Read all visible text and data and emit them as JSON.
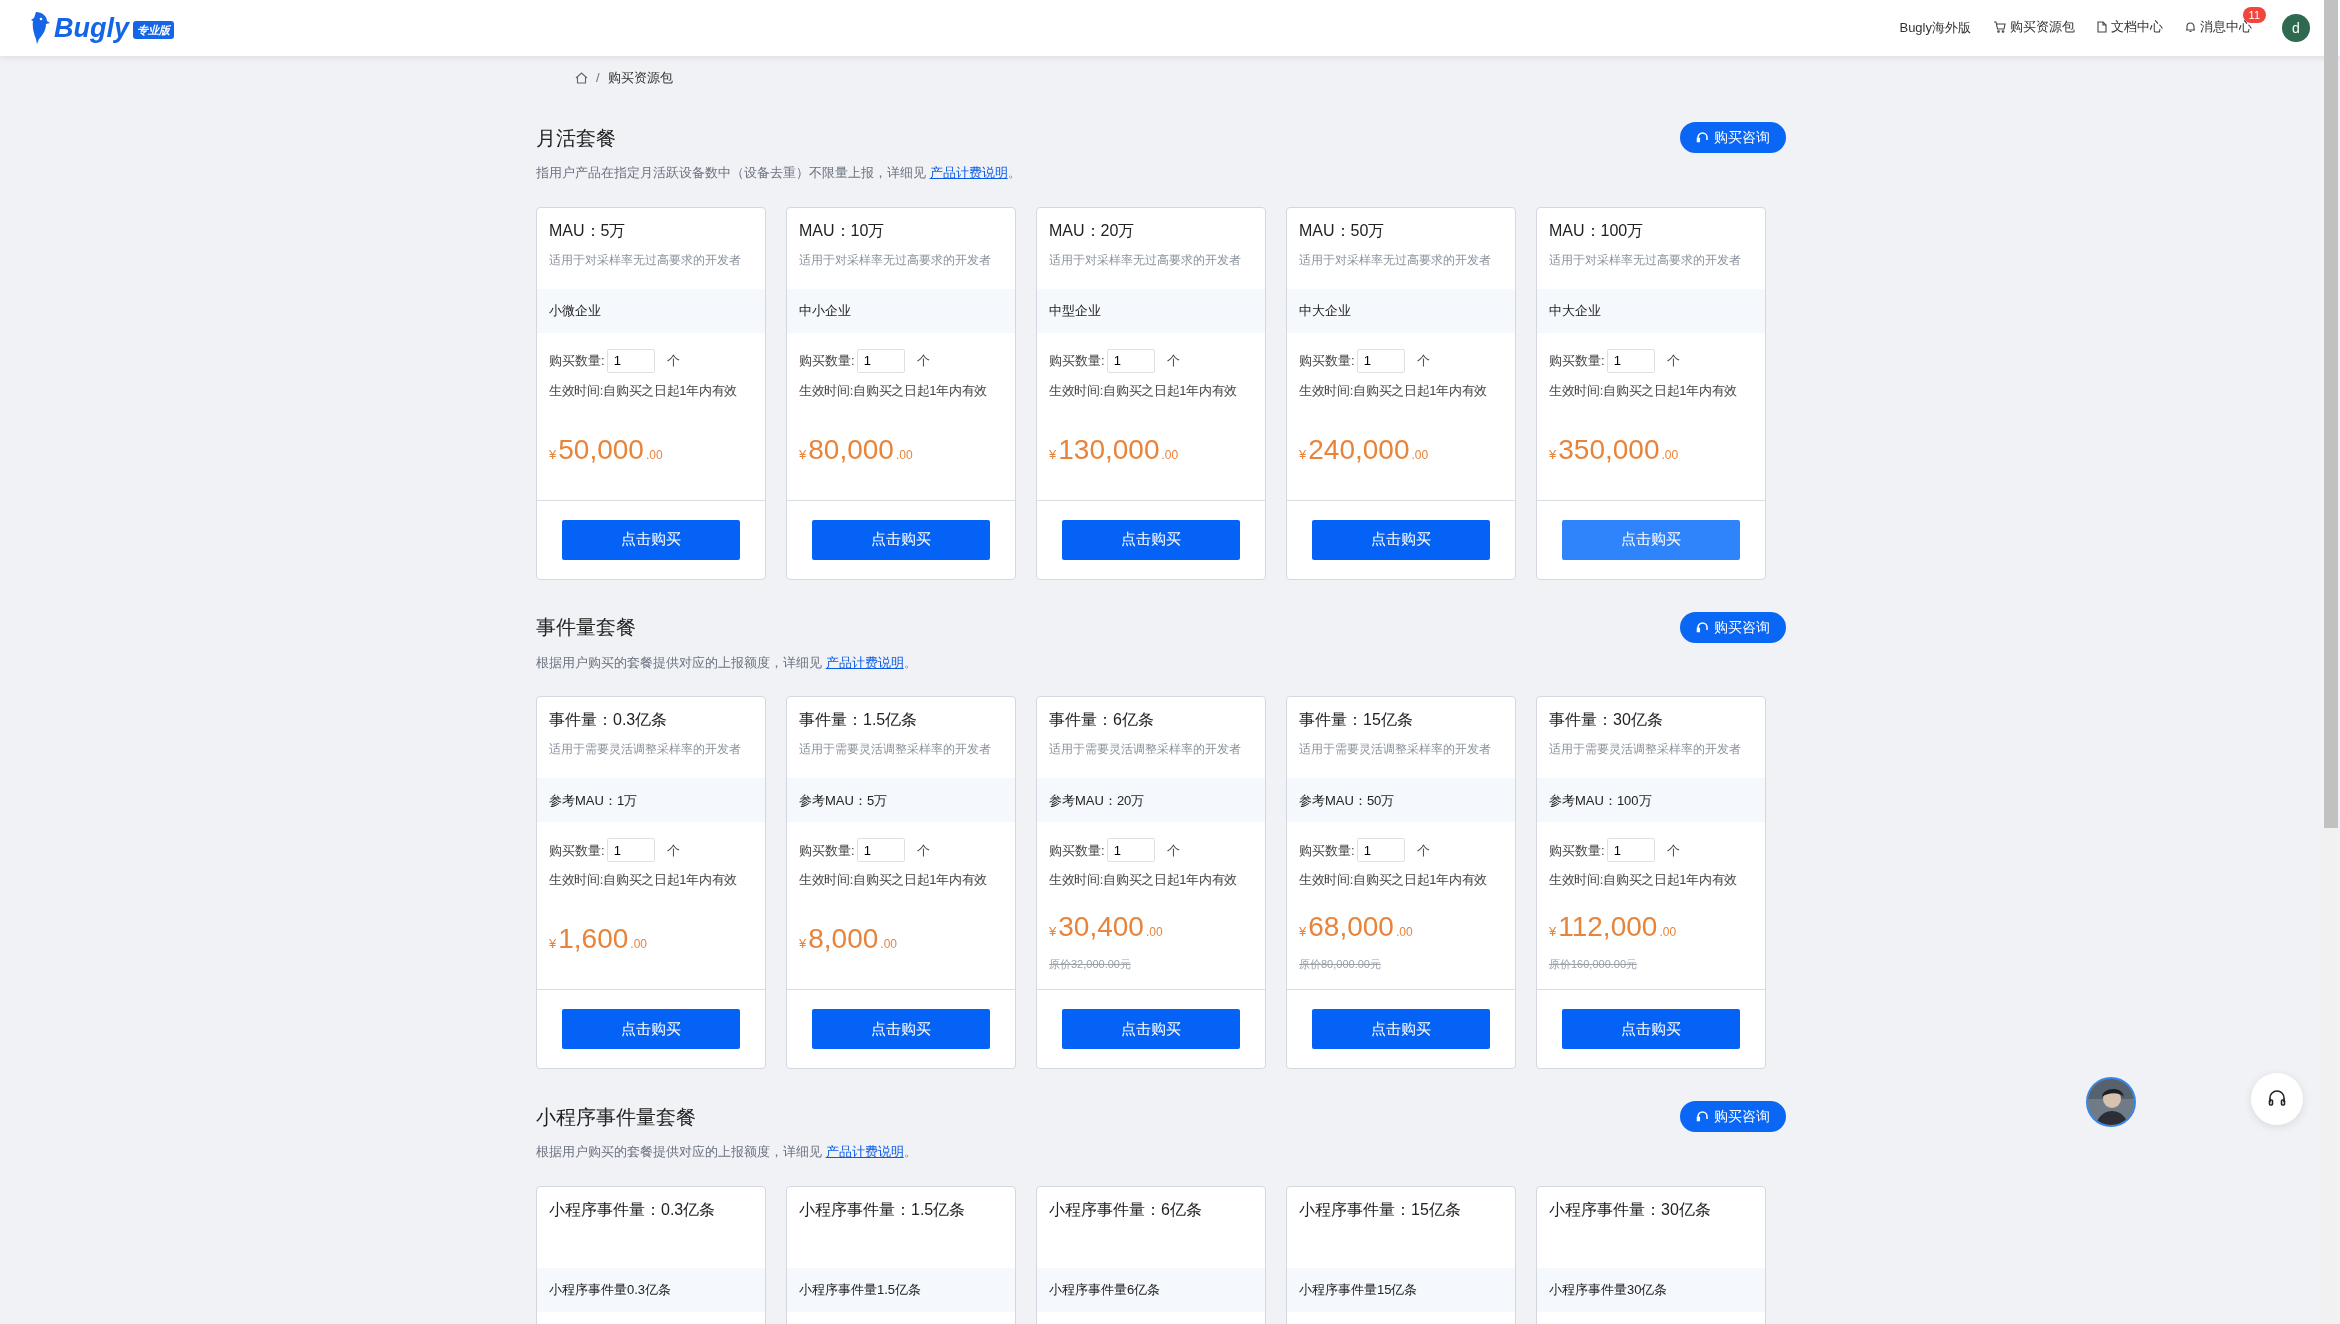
{
  "header": {
    "logo": "Bugly",
    "edition": "专业版",
    "nav": [
      {
        "label": "Bugly海外版",
        "kind": "plain"
      },
      {
        "label": "购买资源包",
        "kind": "cart"
      },
      {
        "label": "文档中心",
        "kind": "document"
      },
      {
        "label": "消息中心",
        "kind": "bell",
        "badge": "11"
      }
    ],
    "user_initial": "d"
  },
  "breadcrumb": {
    "separator": "/",
    "items": [
      "购买资源包"
    ]
  },
  "sections": [
    {
      "title": "月活套餐",
      "description": "指用户产品在指定月活跃设备数中（设备去重）不限量上报，详细见 ",
      "link": "产品计费说明",
      "suffix": "。",
      "consult_button": "购买咨询",
      "plans": [
        {
          "title": "MAU：5万",
          "subtitle": "适用于对采样率无过高要求的开发者",
          "tier": "小微企业",
          "quantity_label": "购买数量:",
          "quantity": "1",
          "unit": "个",
          "validity": "生效时间:自购买之日起1年内有效",
          "currency": "¥",
          "price": "50,000",
          "cents": ".00",
          "button": "点击购买",
          "highlighted": false
        },
        {
          "title": "MAU：10万",
          "subtitle": "适用于对采样率无过高要求的开发者",
          "tier": "中小企业",
          "quantity_label": "购买数量:",
          "quantity": "1",
          "unit": "个",
          "validity": "生效时间:自购买之日起1年内有效",
          "currency": "¥",
          "price": "80,000",
          "cents": ".00",
          "button": "点击购买",
          "highlighted": false
        },
        {
          "title": "MAU：20万",
          "subtitle": "适用于对采样率无过高要求的开发者",
          "tier": "中型企业",
          "quantity_label": "购买数量:",
          "quantity": "1",
          "unit": "个",
          "validity": "生效时间:自购买之日起1年内有效",
          "currency": "¥",
          "price": "130,000",
          "cents": ".00",
          "button": "点击购买",
          "highlighted": false
        },
        {
          "title": "MAU：50万",
          "subtitle": "适用于对采样率无过高要求的开发者",
          "tier": "中大企业",
          "quantity_label": "购买数量:",
          "quantity": "1",
          "unit": "个",
          "validity": "生效时间:自购买之日起1年内有效",
          "currency": "¥",
          "price": "240,000",
          "cents": ".00",
          "button": "点击购买",
          "highlighted": false
        },
        {
          "title": "MAU：100万",
          "subtitle": "适用于对采样率无过高要求的开发者",
          "tier": "中大企业",
          "quantity_label": "购买数量:",
          "quantity": "1",
          "unit": "个",
          "validity": "生效时间:自购买之日起1年内有效",
          "currency": "¥",
          "price": "350,000",
          "cents": ".00",
          "button": "点击购买",
          "highlighted": true
        }
      ]
    },
    {
      "title": "事件量套餐",
      "description": "根据用户购买的套餐提供对应的上报额度，详细见 ",
      "link": "产品计费说明",
      "suffix": "。",
      "consult_button": "购买咨询",
      "plans": [
        {
          "title": "事件量：0.3亿条",
          "subtitle": "适用于需要灵活调整采样率的开发者",
          "tier": "参考MAU：1万",
          "quantity_label": "购买数量:",
          "quantity": "1",
          "unit": "个",
          "validity": "生效时间:自购买之日起1年内有效",
          "currency": "¥",
          "price": "1,600",
          "cents": ".00",
          "button": "点击购买",
          "highlighted": false
        },
        {
          "title": "事件量：1.5亿条",
          "subtitle": "适用于需要灵活调整采样率的开发者",
          "tier": "参考MAU：5万",
          "quantity_label": "购买数量:",
          "quantity": "1",
          "unit": "个",
          "validity": "生效时间:自购买之日起1年内有效",
          "currency": "¥",
          "price": "8,000",
          "cents": ".00",
          "button": "点击购买",
          "highlighted": false
        },
        {
          "title": "事件量：6亿条",
          "subtitle": "适用于需要灵活调整采样率的开发者",
          "tier": "参考MAU：20万",
          "quantity_label": "购买数量:",
          "quantity": "1",
          "unit": "个",
          "validity": "生效时间:自购买之日起1年内有效",
          "currency": "¥",
          "price": "30,400",
          "cents": ".00",
          "original_price": "原价32,000.00元",
          "button": "点击购买",
          "highlighted": false
        },
        {
          "title": "事件量：15亿条",
          "subtitle": "适用于需要灵活调整采样率的开发者",
          "tier": "参考MAU：50万",
          "quantity_label": "购买数量:",
          "quantity": "1",
          "unit": "个",
          "validity": "生效时间:自购买之日起1年内有效",
          "currency": "¥",
          "price": "68,000",
          "cents": ".00",
          "original_price": "原价80,000.00元",
          "button": "点击购买",
          "highlighted": false
        },
        {
          "title": "事件量：30亿条",
          "subtitle": "适用于需要灵活调整采样率的开发者",
          "tier": "参考MAU：100万",
          "quantity_label": "购买数量:",
          "quantity": "1",
          "unit": "个",
          "validity": "生效时间:自购买之日起1年内有效",
          "currency": "¥",
          "price": "112,000",
          "cents": ".00",
          "original_price": "原价160,000.00元",
          "button": "点击购买",
          "highlighted": false
        }
      ]
    },
    {
      "title": "小程序事件量套餐",
      "description": "根据用户购买的套餐提供对应的上报额度，详细见 ",
      "link": "产品计费说明",
      "suffix": "。",
      "consult_button": "购买咨询",
      "plans": [
        {
          "title": "小程序事件量：0.3亿条",
          "tier": "小程序事件量0.3亿条"
        },
        {
          "title": "小程序事件量：1.5亿条",
          "tier": "小程序事件量1.5亿条"
        },
        {
          "title": "小程序事件量：6亿条",
          "tier": "小程序事件量6亿条"
        },
        {
          "title": "小程序事件量：15亿条",
          "tier": "小程序事件量15亿条"
        },
        {
          "title": "小程序事件量：30亿条",
          "tier": "小程序事件量30亿条"
        }
      ]
    }
  ]
}
